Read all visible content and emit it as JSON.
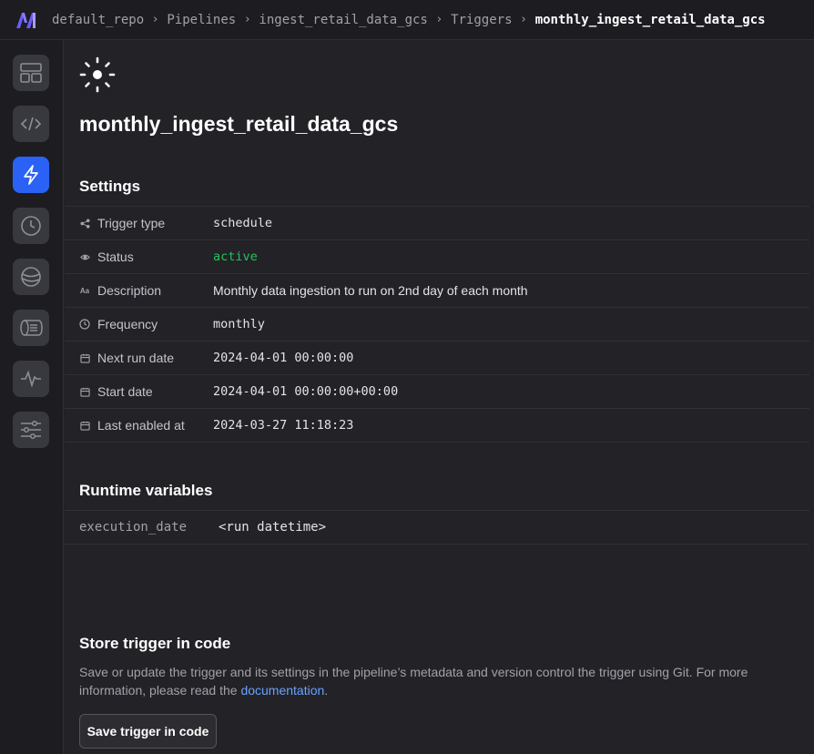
{
  "breadcrumbs": [
    "default_repo",
    "Pipelines",
    "ingest_retail_data_gcs",
    "Triggers",
    "monthly_ingest_retail_data_gcs"
  ],
  "sidebar": {
    "items": [
      {
        "name": "overview",
        "icon": "layout-icon",
        "active": false
      },
      {
        "name": "edit",
        "icon": "code-icon",
        "active": false
      },
      {
        "name": "triggers",
        "icon": "lightning-icon",
        "active": true
      },
      {
        "name": "runs",
        "icon": "clock-icon",
        "active": false
      },
      {
        "name": "backfills",
        "icon": "globe-icon",
        "active": false
      },
      {
        "name": "logs",
        "icon": "logs-icon",
        "active": false
      },
      {
        "name": "monitor",
        "icon": "pulse-icon",
        "active": false
      },
      {
        "name": "settings",
        "icon": "sliders-icon",
        "active": false
      }
    ]
  },
  "page": {
    "icon": "schedule-sun-icon",
    "title": "monthly_ingest_retail_data_gcs"
  },
  "settings": {
    "title": "Settings",
    "rows": [
      {
        "icon": "share-icon",
        "label": "Trigger type",
        "value": "schedule"
      },
      {
        "icon": "status-icon",
        "label": "Status",
        "value": "active"
      },
      {
        "icon": "text-icon",
        "label": "Description",
        "value": "Monthly data ingestion to run on 2nd day of each month"
      },
      {
        "icon": "clock-icon",
        "label": "Frequency",
        "value": "monthly"
      },
      {
        "icon": "calendar-icon",
        "label": "Next run date",
        "value": "2024-04-01 00:00:00"
      },
      {
        "icon": "calendar-icon",
        "label": "Start date",
        "value": "2024-04-01 00:00:00+00:00"
      },
      {
        "icon": "calendar-icon",
        "label": "Last enabled at",
        "value": "2024-03-27 11:18:23"
      }
    ]
  },
  "runtime": {
    "title": "Runtime variables",
    "key": "execution_date",
    "value": "<run datetime>"
  },
  "store": {
    "title": "Store trigger in code",
    "description_before": "Save or update the trigger and its settings in the pipeline’s metadata and version control the trigger using Git. For more information, please read the ",
    "link_text": "documentation",
    "description_after": ".",
    "button_label": "Save trigger in code"
  },
  "colors": {
    "accent": "#2a62f5",
    "status_active": "#22c55e",
    "link": "#6aa1ff"
  }
}
